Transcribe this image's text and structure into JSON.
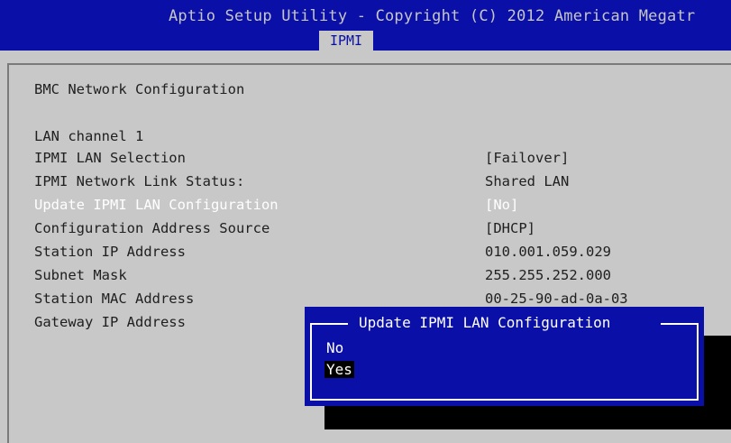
{
  "header": {
    "title": "Aptio Setup Utility - Copyright (C) 2012 American Megatr",
    "tab": "IPMI"
  },
  "section": {
    "heading": "BMC Network Configuration",
    "lan_channel": "LAN channel 1"
  },
  "settings": [
    {
      "label": "IPMI LAN Selection",
      "value": "[Failover]"
    },
    {
      "label": "IPMI Network Link Status:",
      "value": "Shared LAN"
    },
    {
      "label": "Update IPMI LAN Configuration",
      "value": "[No]"
    },
    {
      "label": "Configuration Address Source",
      "value": "[DHCP]"
    },
    {
      "label": "Station IP Address",
      "value": "010.001.059.029"
    },
    {
      "label": "Subnet Mask",
      "value": "255.255.252.000"
    },
    {
      "label": "Station MAC Address",
      "value": "00-25-90-ad-0a-03"
    },
    {
      "label": "Gateway IP Address",
      "value": ""
    }
  ],
  "popup": {
    "title": "Update IPMI LAN Configuration",
    "options": [
      "No",
      "Yes"
    ],
    "selected": "Yes"
  },
  "colors": {
    "header_bg": "#0a0fa8",
    "body_bg": "#c8c8c8",
    "highlight_text": "#ffffff"
  }
}
